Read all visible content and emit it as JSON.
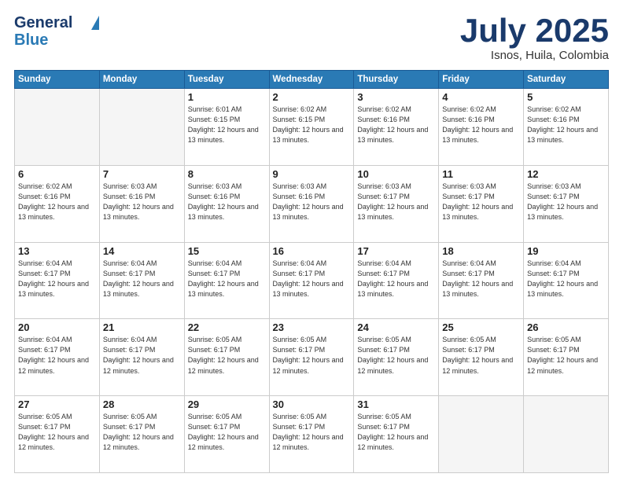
{
  "header": {
    "logo_line1": "General",
    "logo_line2": "Blue",
    "month": "July 2025",
    "location": "Isnos, Huila, Colombia"
  },
  "days_of_week": [
    "Sunday",
    "Monday",
    "Tuesday",
    "Wednesday",
    "Thursday",
    "Friday",
    "Saturday"
  ],
  "weeks": [
    [
      {
        "day": "",
        "empty": true
      },
      {
        "day": "",
        "empty": true
      },
      {
        "day": "1",
        "sunrise": "6:01 AM",
        "sunset": "6:15 PM",
        "daylight": "12 hours and 13 minutes."
      },
      {
        "day": "2",
        "sunrise": "6:02 AM",
        "sunset": "6:15 PM",
        "daylight": "12 hours and 13 minutes."
      },
      {
        "day": "3",
        "sunrise": "6:02 AM",
        "sunset": "6:16 PM",
        "daylight": "12 hours and 13 minutes."
      },
      {
        "day": "4",
        "sunrise": "6:02 AM",
        "sunset": "6:16 PM",
        "daylight": "12 hours and 13 minutes."
      },
      {
        "day": "5",
        "sunrise": "6:02 AM",
        "sunset": "6:16 PM",
        "daylight": "12 hours and 13 minutes."
      }
    ],
    [
      {
        "day": "6",
        "sunrise": "6:02 AM",
        "sunset": "6:16 PM",
        "daylight": "12 hours and 13 minutes."
      },
      {
        "day": "7",
        "sunrise": "6:03 AM",
        "sunset": "6:16 PM",
        "daylight": "12 hours and 13 minutes."
      },
      {
        "day": "8",
        "sunrise": "6:03 AM",
        "sunset": "6:16 PM",
        "daylight": "12 hours and 13 minutes."
      },
      {
        "day": "9",
        "sunrise": "6:03 AM",
        "sunset": "6:16 PM",
        "daylight": "12 hours and 13 minutes."
      },
      {
        "day": "10",
        "sunrise": "6:03 AM",
        "sunset": "6:17 PM",
        "daylight": "12 hours and 13 minutes."
      },
      {
        "day": "11",
        "sunrise": "6:03 AM",
        "sunset": "6:17 PM",
        "daylight": "12 hours and 13 minutes."
      },
      {
        "day": "12",
        "sunrise": "6:03 AM",
        "sunset": "6:17 PM",
        "daylight": "12 hours and 13 minutes."
      }
    ],
    [
      {
        "day": "13",
        "sunrise": "6:04 AM",
        "sunset": "6:17 PM",
        "daylight": "12 hours and 13 minutes."
      },
      {
        "day": "14",
        "sunrise": "6:04 AM",
        "sunset": "6:17 PM",
        "daylight": "12 hours and 13 minutes."
      },
      {
        "day": "15",
        "sunrise": "6:04 AM",
        "sunset": "6:17 PM",
        "daylight": "12 hours and 13 minutes."
      },
      {
        "day": "16",
        "sunrise": "6:04 AM",
        "sunset": "6:17 PM",
        "daylight": "12 hours and 13 minutes."
      },
      {
        "day": "17",
        "sunrise": "6:04 AM",
        "sunset": "6:17 PM",
        "daylight": "12 hours and 13 minutes."
      },
      {
        "day": "18",
        "sunrise": "6:04 AM",
        "sunset": "6:17 PM",
        "daylight": "12 hours and 13 minutes."
      },
      {
        "day": "19",
        "sunrise": "6:04 AM",
        "sunset": "6:17 PM",
        "daylight": "12 hours and 13 minutes."
      }
    ],
    [
      {
        "day": "20",
        "sunrise": "6:04 AM",
        "sunset": "6:17 PM",
        "daylight": "12 hours and 12 minutes."
      },
      {
        "day": "21",
        "sunrise": "6:04 AM",
        "sunset": "6:17 PM",
        "daylight": "12 hours and 12 minutes."
      },
      {
        "day": "22",
        "sunrise": "6:05 AM",
        "sunset": "6:17 PM",
        "daylight": "12 hours and 12 minutes."
      },
      {
        "day": "23",
        "sunrise": "6:05 AM",
        "sunset": "6:17 PM",
        "daylight": "12 hours and 12 minutes."
      },
      {
        "day": "24",
        "sunrise": "6:05 AM",
        "sunset": "6:17 PM",
        "daylight": "12 hours and 12 minutes."
      },
      {
        "day": "25",
        "sunrise": "6:05 AM",
        "sunset": "6:17 PM",
        "daylight": "12 hours and 12 minutes."
      },
      {
        "day": "26",
        "sunrise": "6:05 AM",
        "sunset": "6:17 PM",
        "daylight": "12 hours and 12 minutes."
      }
    ],
    [
      {
        "day": "27",
        "sunrise": "6:05 AM",
        "sunset": "6:17 PM",
        "daylight": "12 hours and 12 minutes."
      },
      {
        "day": "28",
        "sunrise": "6:05 AM",
        "sunset": "6:17 PM",
        "daylight": "12 hours and 12 minutes."
      },
      {
        "day": "29",
        "sunrise": "6:05 AM",
        "sunset": "6:17 PM",
        "daylight": "12 hours and 12 minutes."
      },
      {
        "day": "30",
        "sunrise": "6:05 AM",
        "sunset": "6:17 PM",
        "daylight": "12 hours and 12 minutes."
      },
      {
        "day": "31",
        "sunrise": "6:05 AM",
        "sunset": "6:17 PM",
        "daylight": "12 hours and 12 minutes."
      },
      {
        "day": "",
        "empty": true
      },
      {
        "day": "",
        "empty": true
      }
    ]
  ]
}
